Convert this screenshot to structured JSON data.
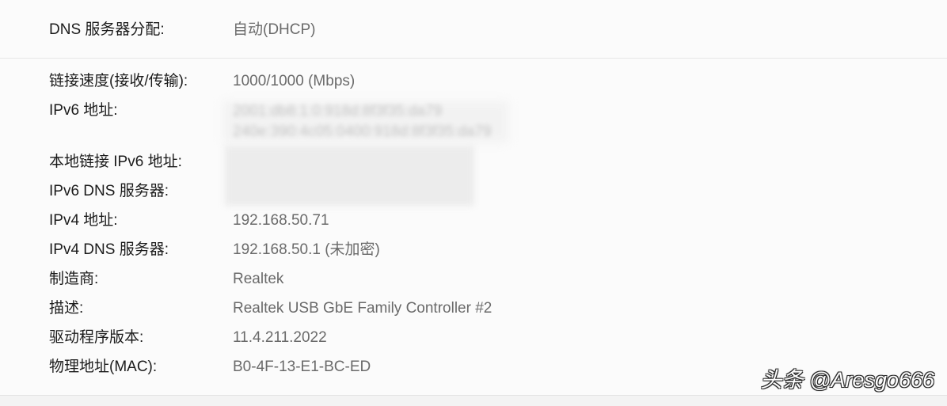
{
  "dns_assignment": {
    "label": "DNS 服务器分配:",
    "value": "自动(DHCP)"
  },
  "properties": [
    {
      "label": "链接速度(接收/传输):",
      "value": "1000/1000 (Mbps)"
    },
    {
      "label": "IPv6 地址:",
      "value_line1": "2001:db8:1:0:918d:8f3f35:da79",
      "value_line2": "240e:390:4c05:0400:918d:8f3f35:da79"
    },
    {
      "label": "本地链接 IPv6 地址:",
      "value": ""
    },
    {
      "label": "IPv6 DNS 服务器:",
      "value": ""
    },
    {
      "label": "IPv4 地址:",
      "value": "192.168.50.71"
    },
    {
      "label": "IPv4 DNS 服务器:",
      "value": "192.168.50.1 (未加密)"
    },
    {
      "label": "制造商:",
      "value": "Realtek"
    },
    {
      "label": "描述:",
      "value": "Realtek USB GbE Family Controller #2"
    },
    {
      "label": "驱动程序版本:",
      "value": "11.4.211.2022"
    },
    {
      "label": "物理地址(MAC):",
      "value": "B0-4F-13-E1-BC-ED"
    }
  ],
  "watermark": "头条 @Aresgo666"
}
